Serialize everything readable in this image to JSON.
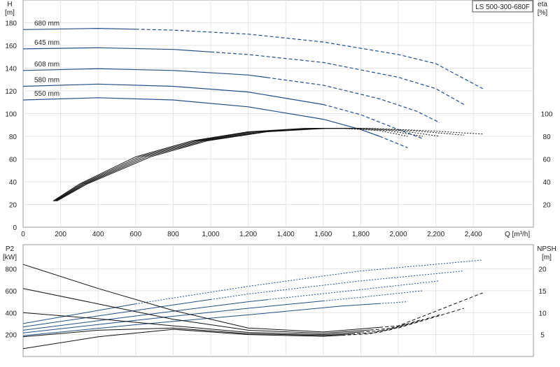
{
  "badge": "LS 500-300-680F",
  "colors": {
    "blue": "#1f4e8c",
    "black": "#111111",
    "grid": "#e4e4e4",
    "frame": "#9a9a9a"
  },
  "chart_data": [
    {
      "id": "head",
      "type": "line",
      "ylabel": "H",
      "yunit": "[m]",
      "right_label": "eta",
      "right_unit": "[%]",
      "xlabel": "Q [m³/h]",
      "xlim": [
        0,
        2720
      ],
      "ylim": [
        0,
        200
      ],
      "right_ylim": [
        0,
        200
      ],
      "x_ticks": [
        0,
        200,
        400,
        600,
        800,
        1000,
        1200,
        1400,
        1600,
        1800,
        2000,
        2200,
        2400
      ],
      "x_tick_labels": [
        "0",
        "200",
        "400",
        "600",
        "800",
        "1,000",
        "1,200",
        "1,400",
        "1,600",
        "1,800",
        "2,000",
        "2,200",
        "2,400"
      ],
      "y_ticks": [
        0,
        20,
        40,
        60,
        80,
        100,
        120,
        140,
        160,
        180
      ],
      "right_ticks": [
        20,
        40,
        60,
        80,
        100
      ],
      "grid": true,
      "series": [
        {
          "name": "680 mm",
          "solid_end": 600,
          "points": [
            [
              0,
              174
            ],
            [
              400,
              175
            ],
            [
              800,
              173.5
            ],
            [
              1200,
              170
            ],
            [
              1600,
              163
            ],
            [
              2000,
              152
            ],
            [
              2200,
              144
            ],
            [
              2450,
              122
            ]
          ]
        },
        {
          "name": "645 mm",
          "solid_end": 1000,
          "points": [
            [
              0,
              157
            ],
            [
              400,
              158
            ],
            [
              800,
              156.5
            ],
            [
              1200,
              152
            ],
            [
              1600,
              145
            ],
            [
              2000,
              132
            ],
            [
              2200,
              122
            ],
            [
              2350,
              108
            ]
          ]
        },
        {
          "name": "608 mm",
          "solid_end": 1300,
          "points": [
            [
              0,
              138
            ],
            [
              400,
              139.5
            ],
            [
              800,
              138
            ],
            [
              1200,
              134
            ],
            [
              1600,
              125
            ],
            [
              1900,
              113
            ],
            [
              2100,
              102
            ],
            [
              2220,
              92
            ]
          ]
        },
        {
          "name": "580 mm",
          "solid_end": 1600,
          "points": [
            [
              0,
              124
            ],
            [
              400,
              126
            ],
            [
              800,
              124
            ],
            [
              1200,
              119
            ],
            [
              1600,
              108
            ],
            [
              1800,
              99
            ],
            [
              2000,
              86
            ],
            [
              2130,
              78
            ]
          ]
        },
        {
          "name": "550 mm",
          "solid_end": 1900,
          "points": [
            [
              0,
              112
            ],
            [
              400,
              114
            ],
            [
              800,
              112
            ],
            [
              1200,
              106
            ],
            [
              1600,
              95
            ],
            [
              1800,
              86
            ],
            [
              1900,
              80
            ],
            [
              2050,
              70
            ]
          ]
        }
      ],
      "efficiency": [
        {
          "solid_end": 1600,
          "points": [
            [
              160,
              23
            ],
            [
              300,
              38
            ],
            [
              600,
              62
            ],
            [
              900,
              76
            ],
            [
              1200,
              84
            ],
            [
              1500,
              87
            ],
            [
              1700,
              87
            ],
            [
              1900,
              85
            ],
            [
              2050,
              80
            ]
          ]
        },
        {
          "solid_end": 1650,
          "points": [
            [
              165,
              23
            ],
            [
              310,
              38
            ],
            [
              620,
              62
            ],
            [
              920,
              76
            ],
            [
              1220,
              84
            ],
            [
              1530,
              87
            ],
            [
              1740,
              87
            ],
            [
              1950,
              85
            ],
            [
              2130,
              80
            ]
          ]
        },
        {
          "solid_end": 1700,
          "points": [
            [
              170,
              23
            ],
            [
              320,
              38
            ],
            [
              640,
              62
            ],
            [
              940,
              76
            ],
            [
              1250,
              84
            ],
            [
              1560,
              87
            ],
            [
              1780,
              87
            ],
            [
              2010,
              85
            ],
            [
              2220,
              80
            ]
          ]
        },
        {
          "solid_end": 1750,
          "points": [
            [
              175,
              23
            ],
            [
              330,
              38
            ],
            [
              660,
              62
            ],
            [
              960,
              76
            ],
            [
              1280,
              84
            ],
            [
              1590,
              87
            ],
            [
              1820,
              87
            ],
            [
              2080,
              85
            ],
            [
              2350,
              81
            ]
          ]
        },
        {
          "solid_end": 1800,
          "points": [
            [
              180,
              23
            ],
            [
              340,
              38
            ],
            [
              680,
              62
            ],
            [
              980,
              76
            ],
            [
              1300,
              84
            ],
            [
              1620,
              87
            ],
            [
              1860,
              87
            ],
            [
              2150,
              85
            ],
            [
              2450,
              82
            ]
          ]
        }
      ]
    },
    {
      "id": "power",
      "type": "line",
      "ylabel": "P2",
      "yunit": "[kW]",
      "right_label": "NPSH",
      "right_unit": "[m]",
      "xlim": [
        0,
        2720
      ],
      "ylim": [
        0,
        1020
      ],
      "right_ylim": [
        0,
        25.5
      ],
      "y_ticks": [
        200,
        400,
        600,
        800
      ],
      "right_ticks": [
        5,
        10,
        15,
        20
      ],
      "grid": true,
      "power_series": [
        {
          "solid_end": 600,
          "points": [
            [
              0,
              300
            ],
            [
              600,
              480
            ],
            [
              1200,
              640
            ],
            [
              1800,
              780
            ],
            [
              2450,
              880
            ]
          ]
        },
        {
          "solid_end": 1000,
          "points": [
            [
              0,
              270
            ],
            [
              600,
              420
            ],
            [
              1200,
              570
            ],
            [
              1800,
              690
            ],
            [
              2350,
              780
            ]
          ]
        },
        {
          "solid_end": 1300,
          "points": [
            [
              0,
              240
            ],
            [
              600,
              370
            ],
            [
              1200,
              500
            ],
            [
              1800,
              610
            ],
            [
              2220,
              690
            ]
          ]
        },
        {
          "solid_end": 1600,
          "points": [
            [
              0,
              215
            ],
            [
              600,
              330
            ],
            [
              1200,
              440
            ],
            [
              1800,
              540
            ],
            [
              2130,
              600
            ]
          ]
        },
        {
          "solid_end": 1900,
          "points": [
            [
              0,
              190
            ],
            [
              600,
              290
            ],
            [
              1200,
              380
            ],
            [
              1700,
              460
            ],
            [
              2050,
              500
            ]
          ]
        }
      ],
      "npsh_series": [
        {
          "solid_end": 1900,
          "points": [
            [
              0,
              21
            ],
            [
              400,
              15.5
            ],
            [
              800,
              10.5
            ],
            [
              1200,
              6.5
            ],
            [
              1600,
              5.6
            ],
            [
              2000,
              7
            ],
            [
              2450,
              14.5
            ]
          ]
        },
        {
          "solid_end": 1850,
          "points": [
            [
              0,
              15.5
            ],
            [
              400,
              12
            ],
            [
              800,
              8.5
            ],
            [
              1200,
              6
            ],
            [
              1600,
              5.3
            ],
            [
              2000,
              6.5
            ],
            [
              2350,
              11
            ]
          ]
        },
        {
          "solid_end": 1800,
          "points": [
            [
              0,
              10
            ],
            [
              400,
              8.6
            ],
            [
              800,
              7
            ],
            [
              1200,
              5.5
            ],
            [
              1600,
              5
            ],
            [
              1950,
              6
            ],
            [
              2220,
              9.5
            ]
          ]
        },
        {
          "solid_end": 1750,
          "points": [
            [
              0,
              4.5
            ],
            [
              400,
              6
            ],
            [
              800,
              6.5
            ],
            [
              1200,
              5.2
            ],
            [
              1600,
              4.8
            ],
            [
              1900,
              5.5
            ],
            [
              2130,
              8.5
            ]
          ]
        },
        {
          "solid_end": 1700,
          "points": [
            [
              0,
              1.8
            ],
            [
              400,
              4.5
            ],
            [
              800,
              6.2
            ],
            [
              1200,
              5
            ],
            [
              1600,
              4.6
            ],
            [
              1850,
              5.2
            ],
            [
              2050,
              7.5
            ]
          ]
        }
      ]
    }
  ]
}
